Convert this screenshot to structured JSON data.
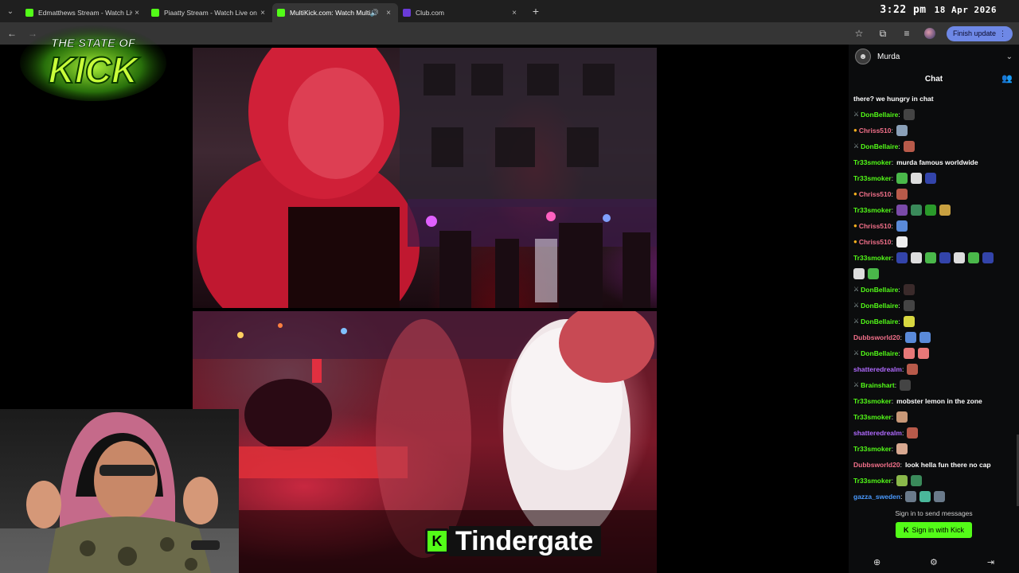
{
  "browser": {
    "tabs": [
      {
        "title": "Edmatthews Stream - Watch Live",
        "favicon": "kick",
        "active": false,
        "audio": false
      },
      {
        "title": "Piaatty Stream - Watch Live on",
        "favicon": "kick",
        "active": false,
        "audio": false
      },
      {
        "title": "MultiKick.com: Watch Multiple",
        "favicon": "multikick",
        "active": true,
        "audio": true
      },
      {
        "title": "Club.com",
        "favicon": "club",
        "active": false,
        "audio": false
      }
    ],
    "finish_update": "Finish update",
    "clock": {
      "time": "3:22 pm",
      "date": "18 Apr 2026"
    }
  },
  "overlay": {
    "logo_text_top": "THE STATE OF",
    "logo_text_main": "KICK",
    "banner_badge": "K",
    "banner_text": "Tindergate"
  },
  "chat": {
    "header_user": "Murda",
    "title": "Chat",
    "messages": [
      {
        "user": "",
        "text": "there? we hungry in chat",
        "color": "#ffffff",
        "badge": ""
      },
      {
        "user": "DonBellaire",
        "text": "",
        "color": "#53fc18",
        "badge": "mod",
        "emotes": [
          "#444444"
        ]
      },
      {
        "user": "Chriss510",
        "text": "",
        "color": "#f2708a",
        "badge": "gift",
        "emotes": [
          "#8aa0b8"
        ]
      },
      {
        "user": "DonBellaire",
        "text": "",
        "color": "#53fc18",
        "badge": "mod",
        "emotes": [
          "#b85a4a"
        ]
      },
      {
        "user": "Tr33smoker",
        "text": "murda famous worldwide",
        "color": "#53fc18",
        "badge": "",
        "emotes": []
      },
      {
        "user": "Tr33smoker",
        "text": "",
        "color": "#53fc18",
        "badge": "",
        "emotes": [
          "#4ab84a",
          "#dddddd",
          "#3344aa"
        ]
      },
      {
        "user": "Chriss510",
        "text": "",
        "color": "#f2708a",
        "badge": "gift",
        "emotes": [
          "#b85a4a"
        ]
      },
      {
        "user": "Tr33smoker",
        "text": "",
        "color": "#53fc18",
        "badge": "",
        "emotes": [
          "#7a4aa8",
          "#3a8a5a",
          "#2a9a2a",
          "#c8a040"
        ]
      },
      {
        "user": "Chriss510",
        "text": "",
        "color": "#f2708a",
        "badge": "gift",
        "emotes": [
          "#5a8ad8"
        ]
      },
      {
        "user": "Chriss510",
        "text": "",
        "color": "#f2708a",
        "badge": "gift",
        "emotes": [
          "#eeeeee"
        ]
      },
      {
        "user": "Tr33smoker",
        "text": "",
        "color": "#53fc18",
        "badge": "",
        "emotes": [
          "#3344aa",
          "#dddddd",
          "#4ab84a",
          "#3344aa",
          "#dddddd",
          "#4ab84a",
          "#3344aa"
        ]
      },
      {
        "user": "",
        "text": "",
        "color": "#ffffff",
        "badge": "",
        "emotes": [
          "#dddddd",
          "#4ab84a"
        ]
      },
      {
        "user": "DonBellaire",
        "text": "",
        "color": "#53fc18",
        "badge": "mod",
        "emotes": [
          "#3a2a2a"
        ]
      },
      {
        "user": "DonBellaire",
        "text": "",
        "color": "#53fc18",
        "badge": "mod",
        "emotes": [
          "#444444"
        ]
      },
      {
        "user": "DonBellaire",
        "text": "",
        "color": "#53fc18",
        "badge": "mod",
        "emotes": [
          "#d8d840"
        ]
      },
      {
        "user": "Dubbsworld20",
        "text": "",
        "color": "#f2708a",
        "badge": "",
        "emotes": [
          "#5a8ad8",
          "#5a8ad8"
        ]
      },
      {
        "user": "DonBellaire",
        "text": "",
        "color": "#53fc18",
        "badge": "mod",
        "emotes": [
          "#e87878",
          "#e87878"
        ]
      },
      {
        "user": "shatteredrealm",
        "text": "",
        "color": "#b06aff",
        "badge": "",
        "emotes": [
          "#b85a4a"
        ]
      },
      {
        "user": "Brainshart",
        "text": "",
        "color": "#53fc18",
        "badge": "mod",
        "emotes": [
          "#444444"
        ]
      },
      {
        "user": "Tr33smoker",
        "text": "mobster lemon in the zone",
        "color": "#53fc18",
        "badge": "",
        "emotes": []
      },
      {
        "user": "Tr33smoker",
        "text": "",
        "color": "#53fc18",
        "badge": "",
        "emotes": [
          "#c89878"
        ]
      },
      {
        "user": "shatteredrealm",
        "text": "",
        "color": "#b06aff",
        "badge": "",
        "emotes": [
          "#b85a4a"
        ]
      },
      {
        "user": "Tr33smoker",
        "text": "",
        "color": "#53fc18",
        "badge": "",
        "emotes": [
          "#d8a890"
        ]
      },
      {
        "user": "Dubbsworld20",
        "text": "look hella fun there no cap",
        "color": "#f2708a",
        "badge": "",
        "emotes": []
      },
      {
        "user": "Tr33smoker",
        "text": "",
        "color": "#53fc18",
        "badge": "",
        "emotes": [
          "#8ab84a",
          "#3a8a5a"
        ]
      },
      {
        "user": "gazza_sweden",
        "text": "",
        "color": "#4a9aff",
        "badge": "",
        "emotes": [
          "#6a7a8a",
          "#4ab89a",
          "#6a7a8a"
        ]
      }
    ],
    "signin_hint": "Sign in to send messages",
    "signin_button": "Sign in with Kick"
  }
}
